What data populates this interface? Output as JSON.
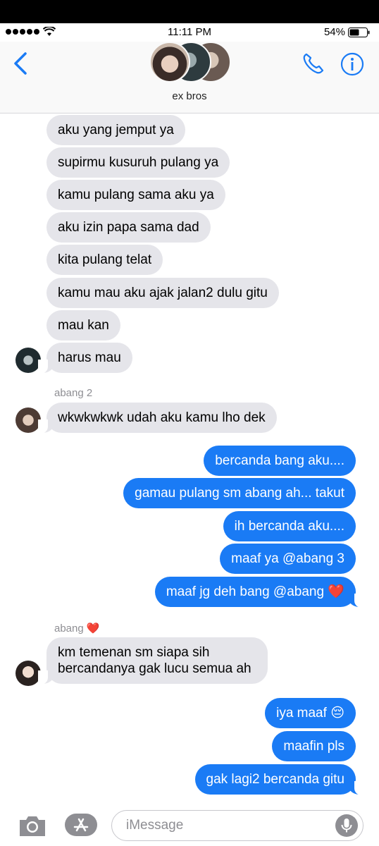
{
  "status_bar": {
    "time": "11:11 PM",
    "battery": "54%"
  },
  "nav": {
    "title": "ex bros",
    "back_icon": "chevron-left-icon",
    "call_icon": "phone-icon",
    "info_icon": "info-icon"
  },
  "colors": {
    "accent": "#1a7bf5",
    "received_bubble": "#e5e5ea",
    "sender_label": "#8e8e93",
    "heart": "#e0142b"
  },
  "messages_received_1": [
    "aku yang jemput ya",
    "supirmu kusuruh pulang ya",
    "kamu pulang sama aku ya",
    "aku izin papa sama dad",
    "kita pulang telat",
    "kamu mau aku ajak jalan2 dulu gitu",
    "mau kan",
    "harus mau"
  ],
  "sender_2": "abang 2",
  "message_abang2": "wkwkwkwk udah aku kamu lho dek",
  "messages_sent_1": [
    "bercanda bang aku....",
    "gamau pulang sm abang ah... takut",
    "ih bercanda aku....",
    "maaf ya @abang 3",
    "maaf jg deh bang @abang"
  ],
  "heart_emoji": "❤️",
  "sender_abang": "abang",
  "message_abang": "km temenan sm siapa sih bercandanya gak lucu semua ah",
  "messages_sent_2": [
    "iya maaf",
    "maafin pls",
    "gak lagi2 bercanda gitu"
  ],
  "pensive_emoji": "😔",
  "input": {
    "placeholder": "iMessage",
    "value": ""
  }
}
